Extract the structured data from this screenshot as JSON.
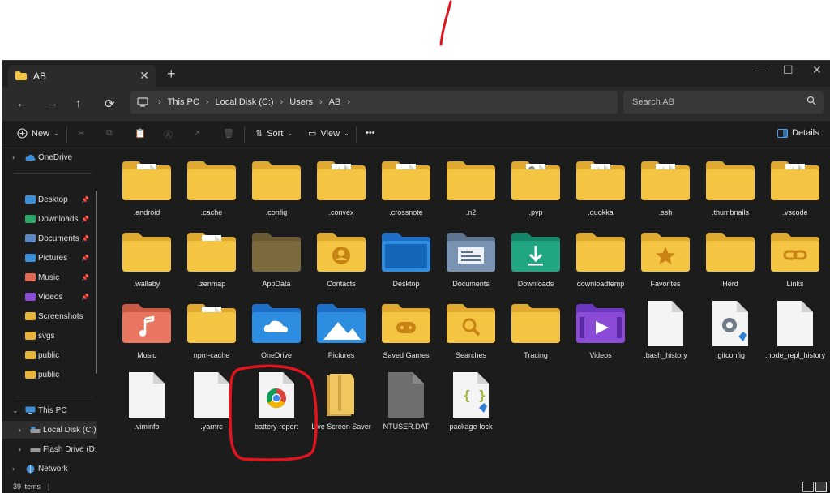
{
  "window": {
    "tab_title": "AB",
    "tab_close": "✕",
    "new_tab": "+",
    "minimize": "—",
    "maximize": "☐",
    "close": "✕"
  },
  "nav": {
    "back": "←",
    "forward": "→",
    "up": "↑",
    "refresh": "⟳",
    "breadcrumb": [
      "This PC",
      "Local Disk (C:)",
      "Users",
      "AB"
    ],
    "search_placeholder": "Search AB"
  },
  "commands": {
    "new": "New",
    "sort": "Sort",
    "view": "View",
    "more": "•••",
    "details": "Details"
  },
  "sidebar": {
    "onedrive": "OneDrive",
    "quick_access": [
      {
        "label": "Desktop",
        "icon": "desktop-icon",
        "color": "#3d8fd8",
        "pinned": true
      },
      {
        "label": "Downloads",
        "icon": "download-icon",
        "color": "#2ea86a",
        "pinned": true
      },
      {
        "label": "Documents",
        "icon": "documents-icon",
        "color": "#5b87c4",
        "pinned": true
      },
      {
        "label": "Pictures",
        "icon": "pictures-icon",
        "color": "#3d8fd8",
        "pinned": true
      },
      {
        "label": "Music",
        "icon": "music-icon",
        "color": "#e06a54",
        "pinned": true
      },
      {
        "label": "Videos",
        "icon": "videos-icon",
        "color": "#8b4bd6",
        "pinned": true
      },
      {
        "label": "Screenshots",
        "icon": "folder-icon",
        "color": "#e8b53b",
        "pinned": false
      },
      {
        "label": "svgs",
        "icon": "folder-icon",
        "color": "#e8b53b",
        "pinned": false
      },
      {
        "label": "public",
        "icon": "folder-icon",
        "color": "#e8b53b",
        "pinned": false
      },
      {
        "label": "public",
        "icon": "folder-icon",
        "color": "#e8b53b",
        "pinned": false
      }
    ],
    "this_pc": "This PC",
    "drives": [
      {
        "label": "Local Disk (C:)",
        "selected": true
      },
      {
        "label": "Flash Drive (D:",
        "selected": false
      }
    ],
    "network": "Network"
  },
  "items": [
    {
      "name": ".android",
      "type": "folder-doc"
    },
    {
      "name": ".cache",
      "type": "folder"
    },
    {
      "name": ".config",
      "type": "folder"
    },
    {
      "name": ".convex",
      "type": "folder-code"
    },
    {
      "name": ".crossnote",
      "type": "folder-doc"
    },
    {
      "name": ".n2",
      "type": "folder"
    },
    {
      "name": ".pyp",
      "type": "folder-gear"
    },
    {
      "name": ".quokka",
      "type": "folder-code"
    },
    {
      "name": ".ssh",
      "type": "folder-code"
    },
    {
      "name": ".thumbnails",
      "type": "folder"
    },
    {
      "name": ".vscode",
      "type": "folder-code"
    },
    {
      "name": ".wallaby",
      "type": "folder"
    },
    {
      "name": ".zenmap",
      "type": "folder-doc"
    },
    {
      "name": "AppData",
      "type": "folder-hidden"
    },
    {
      "name": "Contacts",
      "type": "contacts"
    },
    {
      "name": "Desktop",
      "type": "desktop"
    },
    {
      "name": "Documents",
      "type": "documents"
    },
    {
      "name": "Downloads",
      "type": "downloads"
    },
    {
      "name": "downloadtemp",
      "type": "folder"
    },
    {
      "name": "Favorites",
      "type": "favorites"
    },
    {
      "name": "Herd",
      "type": "folder"
    },
    {
      "name": "Links",
      "type": "links"
    },
    {
      "name": "Music",
      "type": "music"
    },
    {
      "name": "npm-cache",
      "type": "folder-doc"
    },
    {
      "name": "OneDrive",
      "type": "onedrive"
    },
    {
      "name": "Pictures",
      "type": "pictures"
    },
    {
      "name": "Saved Games",
      "type": "games"
    },
    {
      "name": "Searches",
      "type": "searches"
    },
    {
      "name": "Tracing",
      "type": "folder"
    },
    {
      "name": "Videos",
      "type": "videos"
    },
    {
      "name": ".bash_history",
      "type": "file"
    },
    {
      "name": ".gitconfig",
      "type": "file-gear"
    },
    {
      "name": ".node_repl_history",
      "type": "file"
    },
    {
      "name": ".viminfo",
      "type": "file"
    },
    {
      "name": ".yarnrc",
      "type": "file"
    },
    {
      "name": "battery-report",
      "type": "chrome"
    },
    {
      "name": "Live Screen Saver",
      "type": "folder-zip"
    },
    {
      "name": "NTUSER.DAT",
      "type": "file-dark"
    },
    {
      "name": "package-lock",
      "type": "json"
    }
  ],
  "status": {
    "count": "39 items",
    "cursor": "|"
  },
  "colors": {
    "folder": "#f4c542",
    "folder_back": "#e0a92f",
    "annotation": "#e0141e"
  }
}
